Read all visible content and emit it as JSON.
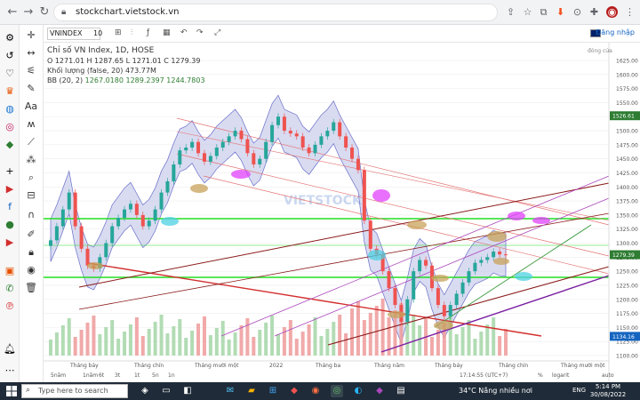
{
  "browser": {
    "url": "stockchart.vietstock.vn",
    "back": "←",
    "forward": "→",
    "reload": "↻"
  },
  "chart_header": {
    "symbol": "VNINDEX",
    "interval": "10",
    "login": "Đăng nhập"
  },
  "legend": {
    "title": "Chỉ số VN Index, 1D, HOSE",
    "ohlc": "O 1271.01 H 1287.65 L 1271.01 C 1279.39",
    "volume": "Khối lượng (false, 20)",
    "volume_val": "473.77M",
    "bb": "BB (20, 2)",
    "bb_vals": "1267.0180  1289.2397  1244.7803",
    "closed": "đóng cửa"
  },
  "watermark": "VIETSTOCK",
  "footer": {
    "ranges": [
      "5năm",
      "1năm",
      "6t",
      "3t",
      "1t",
      "5n",
      "1n"
    ],
    "time": "17:14:55 (UTC+7)",
    "pct": "%",
    "log": "logarit",
    "auto": "auto"
  },
  "chart_data": {
    "type": "line",
    "y_labels": [
      "1625.00",
      "1600.00",
      "1575.00",
      "1550.00",
      "1525.00",
      "1500.00",
      "1475.00",
      "1450.00",
      "1425.00",
      "1400.00",
      "1375.00",
      "1350.00",
      "1325.00",
      "1300.00",
      "1275.00",
      "1250.00",
      "1225.00",
      "1200.00",
      "1175.00",
      "1150.00",
      "1125.00",
      "1100.00"
    ],
    "ylim": [
      1100,
      1625
    ],
    "x_labels": [
      "Tháng bảy",
      "Tháng chín",
      "Tháng mười một",
      "2022",
      "Tháng ba",
      "Tháng năm",
      "Tháng bảy",
      "Tháng chín",
      "Tháng mười một"
    ],
    "price_markers": [
      "1526.61",
      "1279.39",
      "1134.16"
    ],
    "closes": [
      1305,
      1330,
      1360,
      1390,
      1330,
      1290,
      1260,
      1255,
      1275,
      1300,
      1330,
      1345,
      1360,
      1370,
      1350,
      1330,
      1340,
      1360,
      1390,
      1410,
      1440,
      1465,
      1470,
      1480,
      1460,
      1445,
      1455,
      1470,
      1480,
      1490,
      1500,
      1485,
      1460,
      1440,
      1450,
      1480,
      1510,
      1525,
      1500,
      1495,
      1490,
      1470,
      1460,
      1475,
      1490,
      1500,
      1515,
      1490,
      1470,
      1450,
      1430,
      1340,
      1290,
      1280,
      1250,
      1220,
      1190,
      1160,
      1200,
      1250,
      1270,
      1260,
      1220,
      1190,
      1170,
      1190,
      1210,
      1230,
      1250,
      1265,
      1270,
      1275,
      1285,
      1280,
      1279
    ]
  },
  "taskbar": {
    "search": "Type here to search",
    "weather": "34°C  Nắng nhiều nơi",
    "lang": "ENG",
    "time": "5:14 PM",
    "date": "30/08/2022"
  }
}
